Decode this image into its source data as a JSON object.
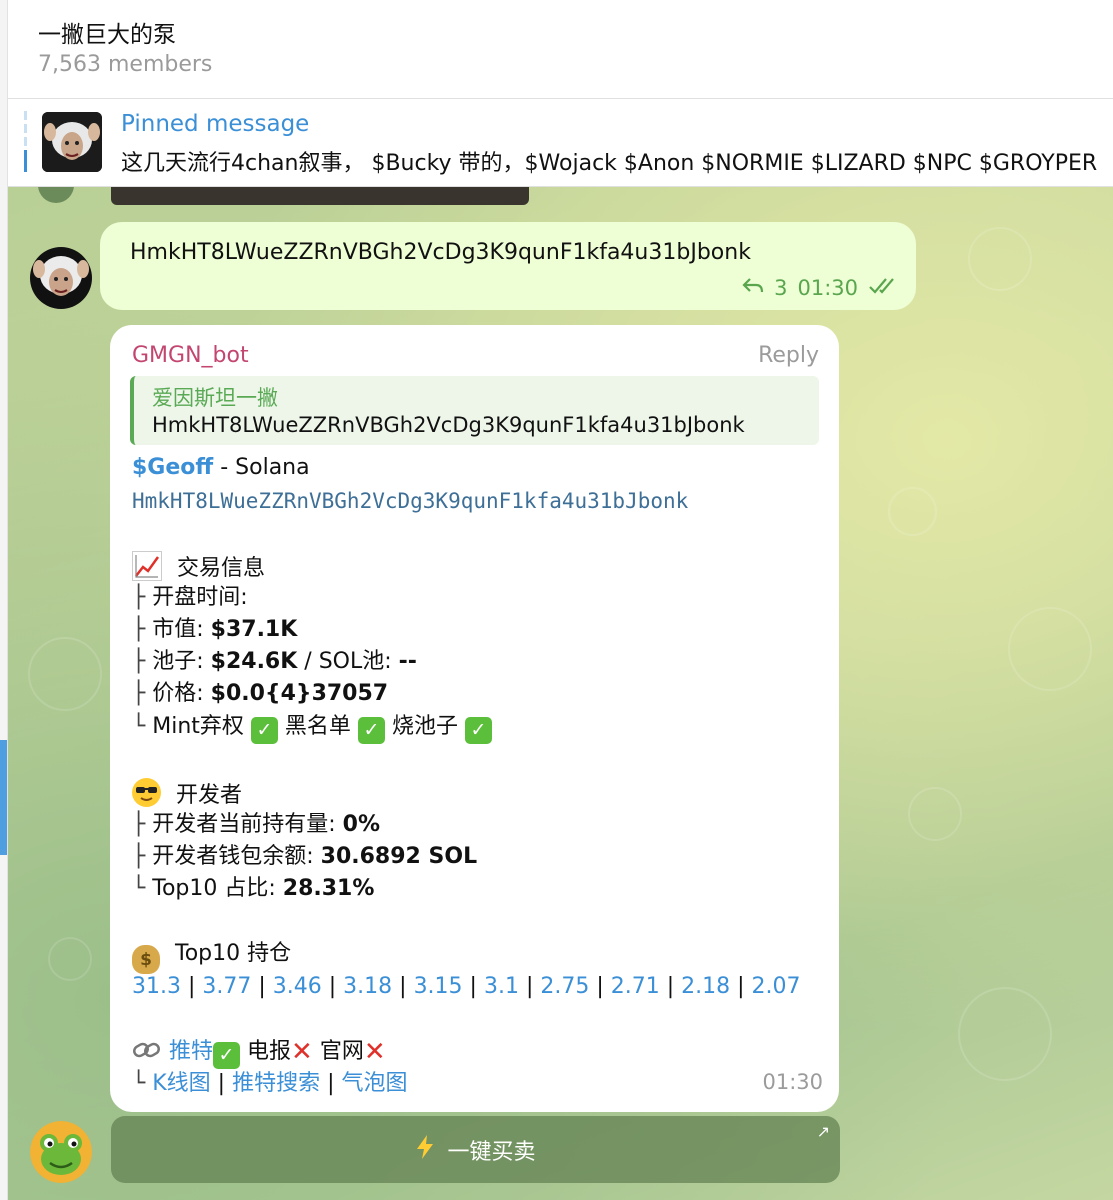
{
  "header": {
    "title": "一撇巨大的泵",
    "members": "7,563 members"
  },
  "pinned": {
    "title": "Pinned message",
    "text": "这几天流行4chan叙事， $Bucky 带的，$Wojack $Anon $NORMIE $LIZARD $NPC $GROYPER"
  },
  "outgoing": {
    "text": "HmkHT8LWueZZRnVBGh2VcDg3K9qunF1kfa4u31bJbonk",
    "replies": "3",
    "time": "01:30"
  },
  "bot_message": {
    "sender": "GMGN_bot",
    "reply_label": "Reply",
    "quote": {
      "author": "爱因斯坦一撇",
      "text": "HmkHT8LWueZZRnVBGh2VcDg3K9qunF1kfa4u31bJbonk"
    },
    "token_link": "$Geoff",
    "chain": " - Solana",
    "address": "HmkHT8LWueZZRnVBGh2VcDg3K9qunF1kfa4u31bJbonk",
    "trade": {
      "header": "交易信息",
      "open_time_label": "开盘时间:",
      "mcap_label": "市值: ",
      "mcap_value": "$37.1K",
      "pool_label": "池子: ",
      "pool_value": "$24.6K",
      "pool_sol": " / SOL池: ",
      "pool_sol_value": "--",
      "price_label": "价格: ",
      "price_value": "$0.0{4}37057",
      "mint_label": "Mint弃权",
      "blacklist_label": "黑名单",
      "burn_label": "烧池子"
    },
    "dev": {
      "header": "开发者",
      "holding_label": "开发者当前持有量: ",
      "holding_value": "0%",
      "wallet_label": "开发者钱包余额: ",
      "wallet_value": "30.6892 SOL",
      "top10_label": "Top10 占比: ",
      "top10_value": "28.31%"
    },
    "holdings": {
      "header": "Top10 持仓",
      "values": [
        "31.3",
        "3.77",
        "3.46",
        "3.18",
        "3.15",
        "3.1",
        "2.75",
        "2.71",
        "2.18",
        "2.07"
      ]
    },
    "links": {
      "twitter": "推特",
      "telegram": "电报",
      "website": "官网",
      "kline": "K线图",
      "twitter_search": "推特搜索",
      "bubble": "气泡图"
    },
    "time": "01:30"
  },
  "keyboard": {
    "button_label": "一键买卖"
  }
}
